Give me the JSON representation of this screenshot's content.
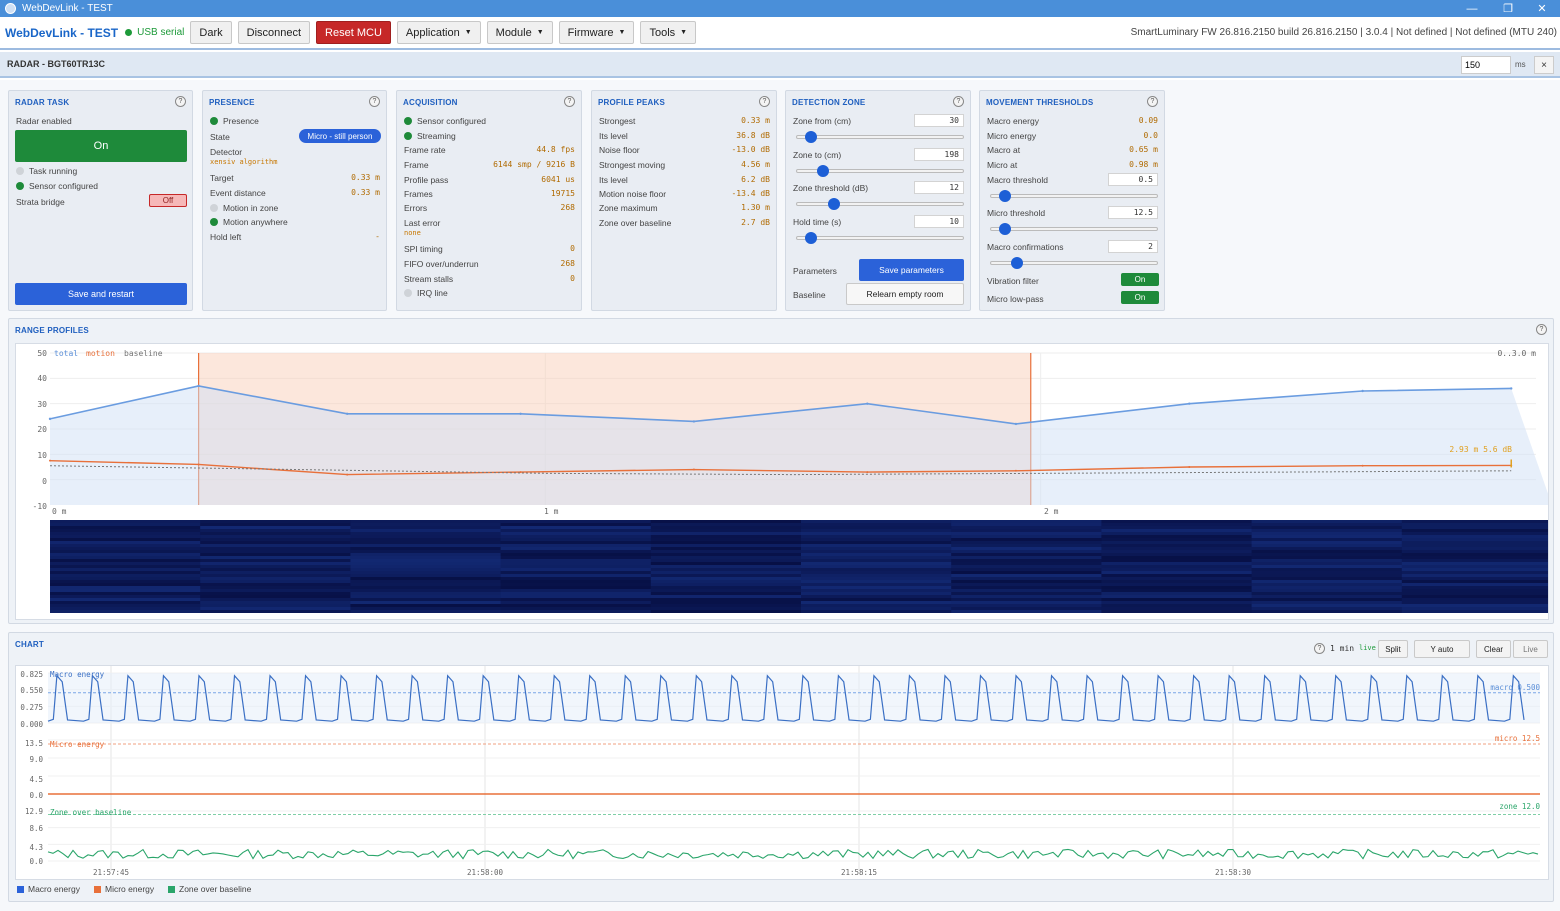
{
  "window": {
    "title": "WebDevLink - TEST"
  },
  "toolbar": {
    "brand": "WebDevLink - TEST",
    "connection": "USB serial",
    "dark": "Dark",
    "disconnect": "Disconnect",
    "reset": "Reset MCU",
    "application": "Application",
    "module": "Module",
    "firmware": "Firmware",
    "tools": "Tools",
    "fw_info": "SmartLuminary FW 26.816.2150 build 26.816.2150 | 3.0.4 | Not defined | Not defined (MTU 240)"
  },
  "radar": {
    "title": "RADAR - BGT60TR13C",
    "interval": "150",
    "interval_unit": "ms",
    "close": "×"
  },
  "radar_task": {
    "title": "RADAR TASK",
    "enabled_label": "Radar enabled",
    "enabled_btn": "On",
    "task_running": "Task running",
    "sensor_configured": "Sensor configured",
    "strata_bridge": "Strata bridge",
    "strata_state": "Off",
    "save_restart": "Save and restart"
  },
  "presence": {
    "title": "PRESENCE",
    "presence": "Presence",
    "state_label": "State",
    "state_value": "Micro - still person",
    "detector_label": "Detector",
    "detector_value": "xensiv algorithm",
    "target_label": "Target",
    "target_value": "0.33 m",
    "event_label": "Event distance",
    "event_value": "0.33 m",
    "motion_zone": "Motion in zone",
    "motion_anywhere": "Motion anywhere",
    "hold_label": "Hold left",
    "hold_value": "-"
  },
  "acquisition": {
    "title": "ACQUISITION",
    "sensor_configured": "Sensor configured",
    "streaming": "Streaming",
    "rows": [
      {
        "label": "Frame rate",
        "value": "44.8 fps"
      },
      {
        "label": "Frame",
        "value": "6144 smp / 9216 B"
      },
      {
        "label": "Profile pass",
        "value": "6041 us"
      },
      {
        "label": "Frames",
        "value": "19715"
      },
      {
        "label": "Errors",
        "value": "268"
      }
    ],
    "last_error_label": "Last error",
    "last_error_value": "none",
    "rows2": [
      {
        "label": "SPI timing",
        "value": "0"
      },
      {
        "label": "FIFO over/underrun",
        "value": "268"
      },
      {
        "label": "Stream stalls",
        "value": "0"
      }
    ],
    "irq": "IRQ line"
  },
  "profile_peaks": {
    "title": "PROFILE PEAKS",
    "rows": [
      {
        "label": "Strongest",
        "value": "0.33 m"
      },
      {
        "label": "Its level",
        "value": "36.8 dB"
      },
      {
        "label": "Noise floor",
        "value": "-13.0 dB"
      },
      {
        "label": "Strongest moving",
        "value": "4.56 m"
      },
      {
        "label": "Its level",
        "value": "6.2 dB"
      },
      {
        "label": "Motion noise floor",
        "value": "-13.4 dB"
      },
      {
        "label": "Zone maximum",
        "value": "1.30 m"
      },
      {
        "label": "Zone over baseline",
        "value": "2.7 dB"
      }
    ]
  },
  "detection_zone": {
    "title": "DETECTION ZONE",
    "zone_from_label": "Zone from (cm)",
    "zone_from": "30",
    "zone_from_level": 0.05,
    "zone_to_label": "Zone to (cm)",
    "zone_to": "198",
    "zone_to_level": 0.13,
    "threshold_label": "Zone threshold (dB)",
    "threshold": "12",
    "threshold_level": 0.2,
    "hold_label": "Hold time (s)",
    "hold": "10",
    "hold_level": 0.05,
    "parameters_label": "Parameters",
    "save_params": "Save parameters",
    "baseline_label": "Baseline",
    "relearn": "Relearn empty room"
  },
  "movement_thresholds": {
    "title": "MOVEMENT THRESHOLDS",
    "rows": [
      {
        "label": "Macro energy",
        "value": "0.09"
      },
      {
        "label": "Micro energy",
        "value": "0.0"
      },
      {
        "label": "Macro at",
        "value": "0.65 m"
      },
      {
        "label": "Micro at",
        "value": "0.98 m"
      }
    ],
    "macro_threshold_label": "Macro threshold",
    "macro_threshold": "0.5",
    "macro_level": 0.05,
    "micro_threshold_label": "Micro threshold",
    "micro_threshold": "12.5",
    "micro_level": 0.05,
    "macro_conf_label": "Macro confirmations",
    "macro_conf": "2",
    "macro_conf_level": 0.13,
    "vibration_label": "Vibration filter",
    "vibration": "On",
    "lowpass_label": "Micro low-pass",
    "lowpass": "On"
  },
  "range_profiles": {
    "title": "RANGE PROFILES",
    "legend_total": "total",
    "legend_motion": "motion",
    "legend_baseline": "baseline",
    "range_label": "0..3.0 m",
    "y_ticks": [
      "50",
      "40",
      "30",
      "20",
      "10",
      "0",
      "-10"
    ],
    "x_ticks": [
      "0 m",
      "1 m",
      "2 m"
    ],
    "marker_label": "2.93 m  5.6 dB"
  },
  "chart": {
    "title": "CHART",
    "window": "1 min",
    "live_tag": "live",
    "split": "Split",
    "yauto": "Y auto",
    "clear": "Clear",
    "live": "Live",
    "macro_label": "Macro energy",
    "macro_ticks": [
      "0.825",
      "0.550",
      "0.275",
      "0.000"
    ],
    "macro_thr": "macro 0.500",
    "micro_label": "Micro energy",
    "micro_ticks": [
      "13.5",
      "9.0",
      "4.5",
      "0.0"
    ],
    "micro_thr": "micro 12.5",
    "zone_label": "Zone over baseline",
    "zone_ticks": [
      "12.9",
      "8.6",
      "4.3",
      "0.0"
    ],
    "zone_thr": "zone 12.0",
    "time_ticks": [
      "21:57:45",
      "21:58:00",
      "21:58:15",
      "21:58:30"
    ],
    "legend": [
      "Macro energy",
      "Micro energy",
      "Zone over baseline"
    ]
  },
  "colors": {
    "accent": "#1f5fbf",
    "total": "#6a9ce0",
    "motion": "#e8703a",
    "zone": "#2aa56a",
    "on": "#1e8a3a",
    "reset": "#c62828"
  },
  "chart_data": [
    {
      "type": "line",
      "title": "RANGE PROFILES",
      "xlabel": "",
      "ylabel": "",
      "ylim": [
        -10,
        50
      ],
      "xlim": [
        0,
        3.0
      ],
      "series": [
        {
          "name": "total",
          "x": [
            0,
            0.3,
            0.6,
            0.95,
            1.3,
            1.65,
            1.95,
            2.3,
            2.65,
            2.95
          ],
          "values": [
            24,
            37,
            26,
            26,
            23,
            30,
            22,
            30,
            35,
            36
          ]
        },
        {
          "name": "motion",
          "x": [
            0,
            0.3,
            0.6,
            0.95,
            1.3,
            1.65,
            1.95,
            2.3,
            2.65,
            2.95
          ],
          "values": [
            7.5,
            6,
            2,
            3,
            4,
            3,
            3.5,
            5,
            5.5,
            5.6
          ]
        },
        {
          "name": "baseline",
          "x": [
            0,
            0.5,
            1,
            1.5,
            2,
            2.5,
            2.95
          ],
          "values": [
            5.5,
            4,
            2.5,
            2,
            2.5,
            3,
            3.5
          ]
        }
      ],
      "zone_m": [
        0.3,
        1.98
      ]
    },
    {
      "type": "line",
      "title": "Macro energy",
      "ylim": [
        0,
        0.825
      ],
      "threshold": 0.5,
      "series": [
        {
          "name": "Macro energy",
          "period_s": 1.6,
          "peak": 0.78,
          "base": 0.03
        }
      ]
    },
    {
      "type": "line",
      "title": "Micro energy",
      "ylim": [
        0,
        13.5
      ],
      "threshold": 12.5,
      "series": [
        {
          "name": "Micro energy",
          "values": [
            0,
            0,
            0,
            0,
            0,
            0,
            0,
            0,
            0,
            0
          ]
        }
      ]
    },
    {
      "type": "line",
      "title": "Zone over baseline",
      "ylim": [
        0,
        12.9
      ],
      "threshold": 12.0,
      "series": [
        {
          "name": "Zone over baseline",
          "mean": 1.8,
          "spread": 1.2
        }
      ]
    }
  ]
}
